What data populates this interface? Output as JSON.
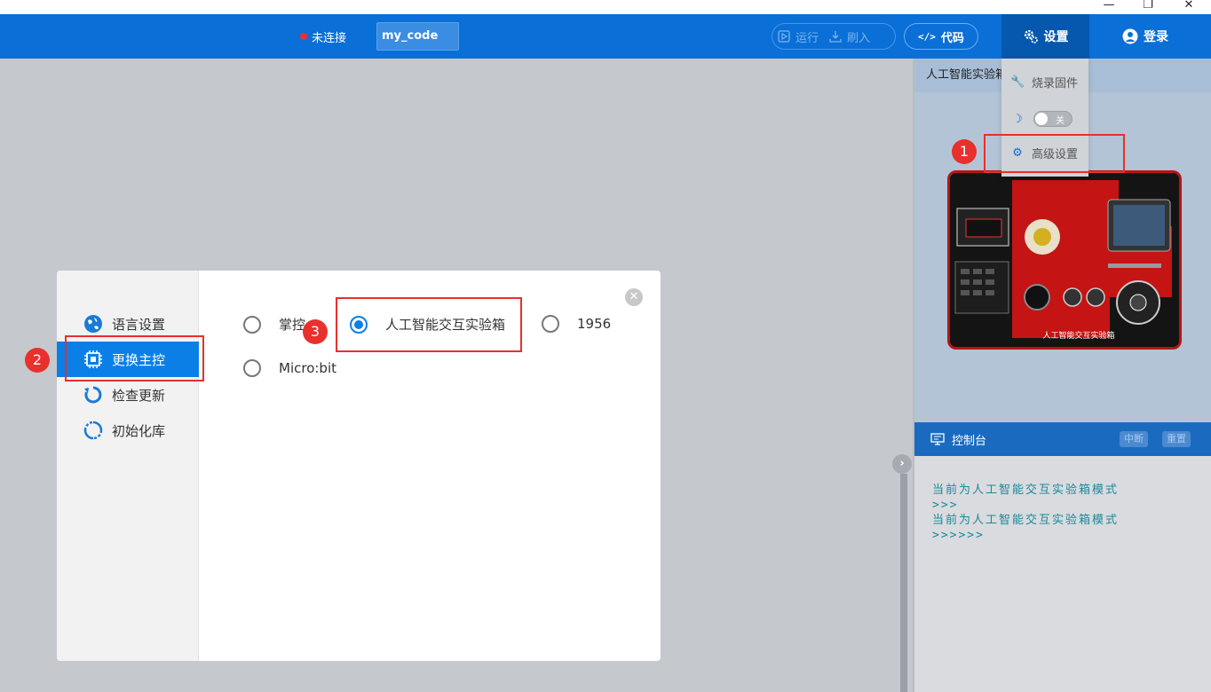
{
  "window_controls": {
    "minimize": "—",
    "restore": "❐",
    "close": "✕"
  },
  "toolbar": {
    "status": "未连接",
    "project_name": "my_code",
    "run_label": "运行",
    "flash_label": "刷入",
    "code_label": "代码",
    "settings_label": "设置",
    "login_label": "登录"
  },
  "settings_menu": {
    "items": [
      {
        "label": "烧录固件",
        "icon": "wrench-icon"
      },
      {
        "label": "",
        "icon": "moon-icon",
        "toggle_label": "关",
        "toggle_on": false
      },
      {
        "label": "高级设置",
        "icon": "gear-icon"
      }
    ]
  },
  "right_panel": {
    "board_title": "人工智能实验箱",
    "board_caption": "人工智能交互实验箱",
    "console_title": "控制台",
    "interrupt_label": "中断",
    "reset_label": "重置",
    "console_lines": [
      "当前为人工智能交互实验箱模式",
      ">>>",
      "当前为人工智能交互实验箱模式",
      ">>>>>>"
    ]
  },
  "modal": {
    "sidebar": [
      {
        "label": "语言设置",
        "icon": "globe-icon",
        "active": false
      },
      {
        "label": "更换主控",
        "icon": "chip-icon",
        "active": true
      },
      {
        "label": "检查更新",
        "icon": "refresh-icon",
        "active": false
      },
      {
        "label": "初始化库",
        "icon": "reset-icon",
        "active": false
      }
    ],
    "options": [
      {
        "label": "掌控",
        "checked": false
      },
      {
        "label": "人工智能交互实验箱",
        "checked": true
      },
      {
        "label": "1956",
        "checked": false
      },
      {
        "label": "Micro:bit",
        "checked": false
      }
    ],
    "close": "✕"
  },
  "annotations": {
    "step1": "1",
    "step2": "2",
    "step3": "3"
  },
  "colors": {
    "toolbar": "#0a6fd6",
    "accent": "#0a80e6",
    "annotation": "#e8302c"
  }
}
